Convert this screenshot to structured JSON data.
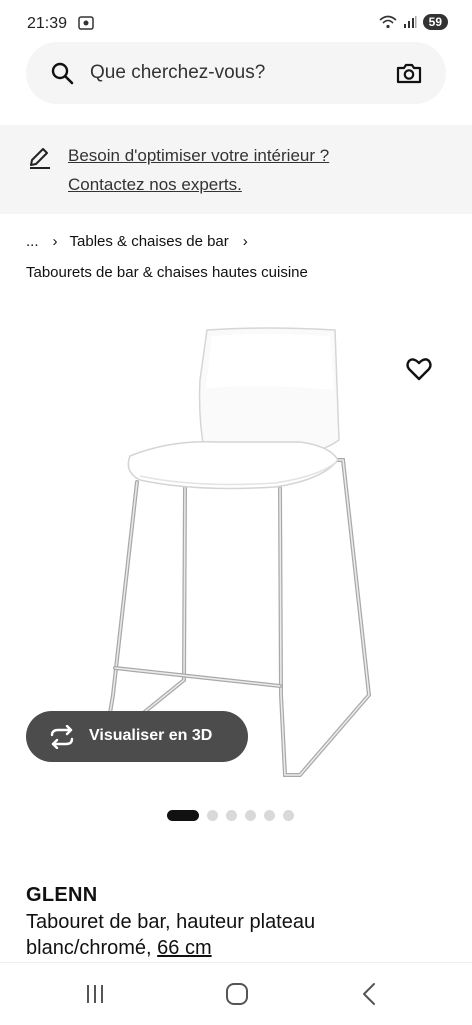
{
  "status_bar": {
    "time": "21:39",
    "battery": "59",
    "icons": [
      "screen-record-icon",
      "wifi-icon",
      "signal-icon",
      "battery-icon"
    ]
  },
  "search": {
    "placeholder": "Que cherchez-vous?",
    "icons": [
      "search-icon",
      "camera-icon"
    ]
  },
  "banner": {
    "line1": "Besoin d'optimiser votre intérieur ?",
    "line2": "Contactez nos experts.",
    "icon": "pencil-icon"
  },
  "breadcrumb": {
    "ellipsis": "...",
    "separator": "›",
    "item1": "Tables & chaises de bar",
    "subcategory": "Tabourets de bar & chaises hautes cuisine"
  },
  "product": {
    "image_icon": "bar-stool-image",
    "favorite_icon": "heart-icon",
    "visualize_label": "Visualiser en 3D",
    "visualize_icon": "rotate-3d-icon",
    "carousel_total": 6,
    "carousel_active": 1,
    "name": "GLENN",
    "desc_line1": "Tabouret de bar, hauteur plateau",
    "desc_line2": "blanc/chromé, ",
    "size": "66 cm"
  },
  "nav": {
    "icons": [
      "recent-apps-icon",
      "home-icon",
      "back-icon"
    ]
  },
  "colors": {
    "surface": "#f5f5f5",
    "button_dark": "#4c4c4c",
    "dot_active": "#111111",
    "dot_inactive": "#d9d9d9"
  }
}
